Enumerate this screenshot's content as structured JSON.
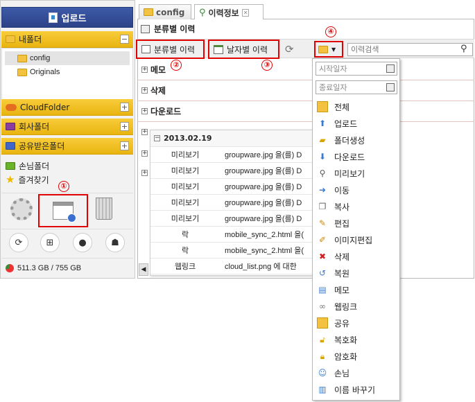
{
  "sidebar": {
    "upload_label": "업로드",
    "my_folder": "내폴더",
    "tree": [
      "config",
      "Originals"
    ],
    "cloud_folder": "CloudFolder",
    "company_folder": "회사폴더",
    "shared_folder": "공유받은폴더",
    "guest_folder": "손님폴더",
    "favorites": "즐겨찾기",
    "storage": "511.3 GB / 755 GB",
    "minus_symbol": "−",
    "plus_symbol": "+"
  },
  "tabs": [
    {
      "label": "config",
      "icon": "folder-icon"
    },
    {
      "label": "이력정보",
      "icon": "history-icon",
      "close": "✕"
    }
  ],
  "content": {
    "title": "분류별 이력",
    "toolbar": {
      "by_category": "분류별 이력",
      "by_date": "날자별 이력",
      "search_placeholder": "이력검색"
    },
    "categories": [
      "메모",
      "삭제",
      "다운로드"
    ],
    "date_group": "2013.02.19",
    "rows": [
      {
        "action": "미리보기",
        "desc": "groupware.jpg 을(를) D"
      },
      {
        "action": "미리보기",
        "desc": "groupware.jpg 을(를) D"
      },
      {
        "action": "미리보기",
        "desc": "groupware.jpg 을(를) D"
      },
      {
        "action": "미리보기",
        "desc": "groupware.jpg 을(를) D"
      },
      {
        "action": "미리보기",
        "desc": "groupware.jpg 을(를) D"
      },
      {
        "action": "락",
        "desc": "mobile_sync_2.html 을("
      },
      {
        "action": "락",
        "desc": "mobile_sync_2.html 을("
      },
      {
        "action": "웹링크",
        "desc": "cloud_list.png 에 대한"
      }
    ]
  },
  "annotations": [
    "①",
    "②",
    "③",
    "④"
  ],
  "menu": {
    "start_date": "시작일자",
    "end_date": "종료일자",
    "items": [
      "전체",
      "업로드",
      "폴더생성",
      "다운로드",
      "미리보기",
      "이동",
      "복사",
      "편집",
      "이미지편집",
      "삭제",
      "복원",
      "메모",
      "웹링크",
      "공유",
      "복호화",
      "암호화",
      "손님",
      "이름 바꾸기"
    ]
  },
  "colors": {
    "accent_blue": "#2c4288",
    "folder_yellow": "#f3c240",
    "annotation_red": "#e00000"
  }
}
